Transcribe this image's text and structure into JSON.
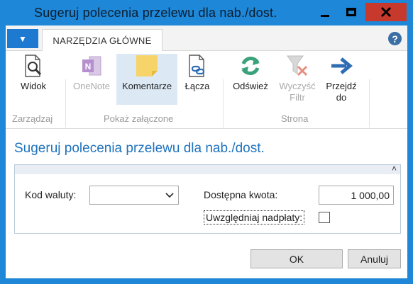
{
  "window": {
    "title": "Sugeruj polecenia przelewu dla nab./dost."
  },
  "ribbon": {
    "file_tab_glyph": "▼",
    "home_tab": "NARZĘDZIA GŁÓWNE",
    "help_glyph": "?",
    "buttons": {
      "view": "Widok",
      "onenote": "OneNote",
      "comments": "Komentarze",
      "links": "Łącza",
      "refresh": "Odśwież",
      "clear_filter_1": "Wyczyść",
      "clear_filter_2": "Filtr",
      "goto_1": "Przejdź",
      "goto_2": "do"
    },
    "groups": {
      "manage": "Zarządzaj",
      "show_attached": "Pokaż załączone",
      "page": "Strona"
    }
  },
  "page": {
    "title": "Sugeruj polecenia przelewu dla nab./dost.",
    "fasttab_chevron": "˄",
    "currency_label": "Kod waluty:",
    "currency_value": "",
    "available_label": "Dostępna kwota:",
    "available_value": "1 000,00",
    "overpay_label": "Uwzględniaj nadpłaty:",
    "overpay_checked": false
  },
  "dialog": {
    "ok": "OK",
    "cancel": "Anuluj"
  },
  "colors": {
    "titlebar": "#1e87d7",
    "close": "#c7392d",
    "page_title": "#1e73be"
  },
  "icons": [
    "view-icon",
    "onenote-icon",
    "comments-icon",
    "links-icon",
    "refresh-icon",
    "clear-filter-icon",
    "goto-arrow-icon",
    "help-icon",
    "chevron-down-icon",
    "collapse-chevron-icon"
  ]
}
